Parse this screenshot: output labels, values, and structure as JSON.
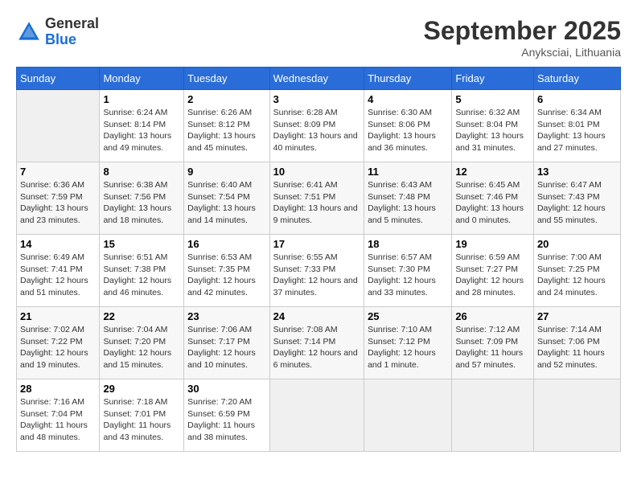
{
  "header": {
    "logo_general": "General",
    "logo_blue": "Blue",
    "month": "September 2025",
    "location": "Anyksciai, Lithuania"
  },
  "days_of_week": [
    "Sunday",
    "Monday",
    "Tuesday",
    "Wednesday",
    "Thursday",
    "Friday",
    "Saturday"
  ],
  "weeks": [
    [
      {
        "day": "",
        "empty": true
      },
      {
        "day": "1",
        "sunrise": "Sunrise: 6:24 AM",
        "sunset": "Sunset: 8:14 PM",
        "daylight": "Daylight: 13 hours and 49 minutes."
      },
      {
        "day": "2",
        "sunrise": "Sunrise: 6:26 AM",
        "sunset": "Sunset: 8:12 PM",
        "daylight": "Daylight: 13 hours and 45 minutes."
      },
      {
        "day": "3",
        "sunrise": "Sunrise: 6:28 AM",
        "sunset": "Sunset: 8:09 PM",
        "daylight": "Daylight: 13 hours and 40 minutes."
      },
      {
        "day": "4",
        "sunrise": "Sunrise: 6:30 AM",
        "sunset": "Sunset: 8:06 PM",
        "daylight": "Daylight: 13 hours and 36 minutes."
      },
      {
        "day": "5",
        "sunrise": "Sunrise: 6:32 AM",
        "sunset": "Sunset: 8:04 PM",
        "daylight": "Daylight: 13 hours and 31 minutes."
      },
      {
        "day": "6",
        "sunrise": "Sunrise: 6:34 AM",
        "sunset": "Sunset: 8:01 PM",
        "daylight": "Daylight: 13 hours and 27 minutes."
      }
    ],
    [
      {
        "day": "7",
        "sunrise": "Sunrise: 6:36 AM",
        "sunset": "Sunset: 7:59 PM",
        "daylight": "Daylight: 13 hours and 23 minutes."
      },
      {
        "day": "8",
        "sunrise": "Sunrise: 6:38 AM",
        "sunset": "Sunset: 7:56 PM",
        "daylight": "Daylight: 13 hours and 18 minutes."
      },
      {
        "day": "9",
        "sunrise": "Sunrise: 6:40 AM",
        "sunset": "Sunset: 7:54 PM",
        "daylight": "Daylight: 13 hours and 14 minutes."
      },
      {
        "day": "10",
        "sunrise": "Sunrise: 6:41 AM",
        "sunset": "Sunset: 7:51 PM",
        "daylight": "Daylight: 13 hours and 9 minutes."
      },
      {
        "day": "11",
        "sunrise": "Sunrise: 6:43 AM",
        "sunset": "Sunset: 7:48 PM",
        "daylight": "Daylight: 13 hours and 5 minutes."
      },
      {
        "day": "12",
        "sunrise": "Sunrise: 6:45 AM",
        "sunset": "Sunset: 7:46 PM",
        "daylight": "Daylight: 13 hours and 0 minutes."
      },
      {
        "day": "13",
        "sunrise": "Sunrise: 6:47 AM",
        "sunset": "Sunset: 7:43 PM",
        "daylight": "Daylight: 12 hours and 55 minutes."
      }
    ],
    [
      {
        "day": "14",
        "sunrise": "Sunrise: 6:49 AM",
        "sunset": "Sunset: 7:41 PM",
        "daylight": "Daylight: 12 hours and 51 minutes."
      },
      {
        "day": "15",
        "sunrise": "Sunrise: 6:51 AM",
        "sunset": "Sunset: 7:38 PM",
        "daylight": "Daylight: 12 hours and 46 minutes."
      },
      {
        "day": "16",
        "sunrise": "Sunrise: 6:53 AM",
        "sunset": "Sunset: 7:35 PM",
        "daylight": "Daylight: 12 hours and 42 minutes."
      },
      {
        "day": "17",
        "sunrise": "Sunrise: 6:55 AM",
        "sunset": "Sunset: 7:33 PM",
        "daylight": "Daylight: 12 hours and 37 minutes."
      },
      {
        "day": "18",
        "sunrise": "Sunrise: 6:57 AM",
        "sunset": "Sunset: 7:30 PM",
        "daylight": "Daylight: 12 hours and 33 minutes."
      },
      {
        "day": "19",
        "sunrise": "Sunrise: 6:59 AM",
        "sunset": "Sunset: 7:27 PM",
        "daylight": "Daylight: 12 hours and 28 minutes."
      },
      {
        "day": "20",
        "sunrise": "Sunrise: 7:00 AM",
        "sunset": "Sunset: 7:25 PM",
        "daylight": "Daylight: 12 hours and 24 minutes."
      }
    ],
    [
      {
        "day": "21",
        "sunrise": "Sunrise: 7:02 AM",
        "sunset": "Sunset: 7:22 PM",
        "daylight": "Daylight: 12 hours and 19 minutes."
      },
      {
        "day": "22",
        "sunrise": "Sunrise: 7:04 AM",
        "sunset": "Sunset: 7:20 PM",
        "daylight": "Daylight: 12 hours and 15 minutes."
      },
      {
        "day": "23",
        "sunrise": "Sunrise: 7:06 AM",
        "sunset": "Sunset: 7:17 PM",
        "daylight": "Daylight: 12 hours and 10 minutes."
      },
      {
        "day": "24",
        "sunrise": "Sunrise: 7:08 AM",
        "sunset": "Sunset: 7:14 PM",
        "daylight": "Daylight: 12 hours and 6 minutes."
      },
      {
        "day": "25",
        "sunrise": "Sunrise: 7:10 AM",
        "sunset": "Sunset: 7:12 PM",
        "daylight": "Daylight: 12 hours and 1 minute."
      },
      {
        "day": "26",
        "sunrise": "Sunrise: 7:12 AM",
        "sunset": "Sunset: 7:09 PM",
        "daylight": "Daylight: 11 hours and 57 minutes."
      },
      {
        "day": "27",
        "sunrise": "Sunrise: 7:14 AM",
        "sunset": "Sunset: 7:06 PM",
        "daylight": "Daylight: 11 hours and 52 minutes."
      }
    ],
    [
      {
        "day": "28",
        "sunrise": "Sunrise: 7:16 AM",
        "sunset": "Sunset: 7:04 PM",
        "daylight": "Daylight: 11 hours and 48 minutes."
      },
      {
        "day": "29",
        "sunrise": "Sunrise: 7:18 AM",
        "sunset": "Sunset: 7:01 PM",
        "daylight": "Daylight: 11 hours and 43 minutes."
      },
      {
        "day": "30",
        "sunrise": "Sunrise: 7:20 AM",
        "sunset": "Sunset: 6:59 PM",
        "daylight": "Daylight: 11 hours and 38 minutes."
      },
      {
        "day": "",
        "empty": true
      },
      {
        "day": "",
        "empty": true
      },
      {
        "day": "",
        "empty": true
      },
      {
        "day": "",
        "empty": true
      }
    ]
  ]
}
